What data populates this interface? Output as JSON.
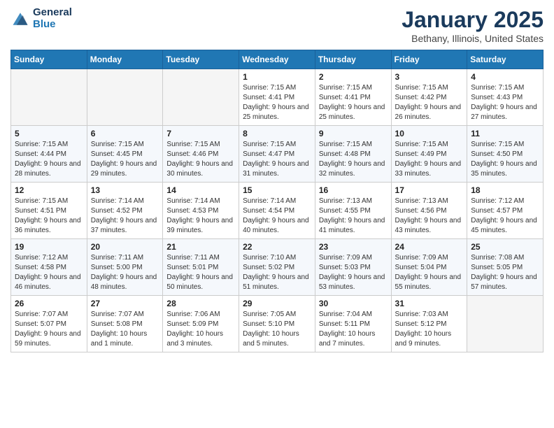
{
  "header": {
    "logo_line1": "General",
    "logo_line2": "Blue",
    "month": "January 2025",
    "location": "Bethany, Illinois, United States"
  },
  "weekdays": [
    "Sunday",
    "Monday",
    "Tuesday",
    "Wednesday",
    "Thursday",
    "Friday",
    "Saturday"
  ],
  "weeks": [
    [
      {
        "day": "",
        "info": ""
      },
      {
        "day": "",
        "info": ""
      },
      {
        "day": "",
        "info": ""
      },
      {
        "day": "1",
        "info": "Sunrise: 7:15 AM\nSunset: 4:41 PM\nDaylight: 9 hours and 25 minutes."
      },
      {
        "day": "2",
        "info": "Sunrise: 7:15 AM\nSunset: 4:41 PM\nDaylight: 9 hours and 25 minutes."
      },
      {
        "day": "3",
        "info": "Sunrise: 7:15 AM\nSunset: 4:42 PM\nDaylight: 9 hours and 26 minutes."
      },
      {
        "day": "4",
        "info": "Sunrise: 7:15 AM\nSunset: 4:43 PM\nDaylight: 9 hours and 27 minutes."
      }
    ],
    [
      {
        "day": "5",
        "info": "Sunrise: 7:15 AM\nSunset: 4:44 PM\nDaylight: 9 hours and 28 minutes."
      },
      {
        "day": "6",
        "info": "Sunrise: 7:15 AM\nSunset: 4:45 PM\nDaylight: 9 hours and 29 minutes."
      },
      {
        "day": "7",
        "info": "Sunrise: 7:15 AM\nSunset: 4:46 PM\nDaylight: 9 hours and 30 minutes."
      },
      {
        "day": "8",
        "info": "Sunrise: 7:15 AM\nSunset: 4:47 PM\nDaylight: 9 hours and 31 minutes."
      },
      {
        "day": "9",
        "info": "Sunrise: 7:15 AM\nSunset: 4:48 PM\nDaylight: 9 hours and 32 minutes."
      },
      {
        "day": "10",
        "info": "Sunrise: 7:15 AM\nSunset: 4:49 PM\nDaylight: 9 hours and 33 minutes."
      },
      {
        "day": "11",
        "info": "Sunrise: 7:15 AM\nSunset: 4:50 PM\nDaylight: 9 hours and 35 minutes."
      }
    ],
    [
      {
        "day": "12",
        "info": "Sunrise: 7:15 AM\nSunset: 4:51 PM\nDaylight: 9 hours and 36 minutes."
      },
      {
        "day": "13",
        "info": "Sunrise: 7:14 AM\nSunset: 4:52 PM\nDaylight: 9 hours and 37 minutes."
      },
      {
        "day": "14",
        "info": "Sunrise: 7:14 AM\nSunset: 4:53 PM\nDaylight: 9 hours and 39 minutes."
      },
      {
        "day": "15",
        "info": "Sunrise: 7:14 AM\nSunset: 4:54 PM\nDaylight: 9 hours and 40 minutes."
      },
      {
        "day": "16",
        "info": "Sunrise: 7:13 AM\nSunset: 4:55 PM\nDaylight: 9 hours and 41 minutes."
      },
      {
        "day": "17",
        "info": "Sunrise: 7:13 AM\nSunset: 4:56 PM\nDaylight: 9 hours and 43 minutes."
      },
      {
        "day": "18",
        "info": "Sunrise: 7:12 AM\nSunset: 4:57 PM\nDaylight: 9 hours and 45 minutes."
      }
    ],
    [
      {
        "day": "19",
        "info": "Sunrise: 7:12 AM\nSunset: 4:58 PM\nDaylight: 9 hours and 46 minutes."
      },
      {
        "day": "20",
        "info": "Sunrise: 7:11 AM\nSunset: 5:00 PM\nDaylight: 9 hours and 48 minutes."
      },
      {
        "day": "21",
        "info": "Sunrise: 7:11 AM\nSunset: 5:01 PM\nDaylight: 9 hours and 50 minutes."
      },
      {
        "day": "22",
        "info": "Sunrise: 7:10 AM\nSunset: 5:02 PM\nDaylight: 9 hours and 51 minutes."
      },
      {
        "day": "23",
        "info": "Sunrise: 7:09 AM\nSunset: 5:03 PM\nDaylight: 9 hours and 53 minutes."
      },
      {
        "day": "24",
        "info": "Sunrise: 7:09 AM\nSunset: 5:04 PM\nDaylight: 9 hours and 55 minutes."
      },
      {
        "day": "25",
        "info": "Sunrise: 7:08 AM\nSunset: 5:05 PM\nDaylight: 9 hours and 57 minutes."
      }
    ],
    [
      {
        "day": "26",
        "info": "Sunrise: 7:07 AM\nSunset: 5:07 PM\nDaylight: 9 hours and 59 minutes."
      },
      {
        "day": "27",
        "info": "Sunrise: 7:07 AM\nSunset: 5:08 PM\nDaylight: 10 hours and 1 minute."
      },
      {
        "day": "28",
        "info": "Sunrise: 7:06 AM\nSunset: 5:09 PM\nDaylight: 10 hours and 3 minutes."
      },
      {
        "day": "29",
        "info": "Sunrise: 7:05 AM\nSunset: 5:10 PM\nDaylight: 10 hours and 5 minutes."
      },
      {
        "day": "30",
        "info": "Sunrise: 7:04 AM\nSunset: 5:11 PM\nDaylight: 10 hours and 7 minutes."
      },
      {
        "day": "31",
        "info": "Sunrise: 7:03 AM\nSunset: 5:12 PM\nDaylight: 10 hours and 9 minutes."
      },
      {
        "day": "",
        "info": ""
      }
    ]
  ]
}
